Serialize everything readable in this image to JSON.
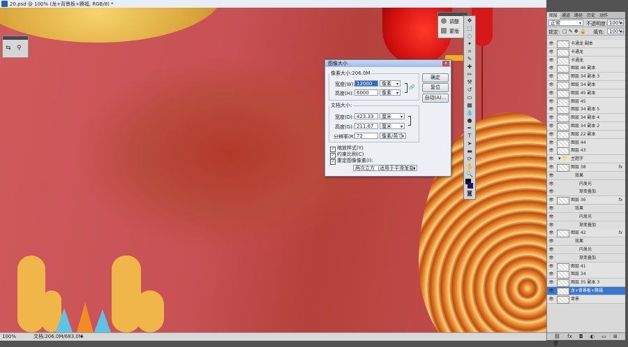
{
  "document": {
    "tab_title": "20.psd @ 100% (龙+背景板+腾福, RGB/8) *"
  },
  "status_bar": {
    "zoom": "100%",
    "doc_info": "文档:206.0M/683.0M"
  },
  "mini_panel": {
    "items": [
      {
        "label": "调整"
      },
      {
        "label": "蒙版"
      }
    ]
  },
  "dialog": {
    "title": "图像大小",
    "close": "x",
    "pixel_dimensions_label": "像素大小:206.0M",
    "width_label": "宽度(W):",
    "width_value": "12000",
    "width_unit": "像素",
    "height_label": "高度(H):",
    "height_value": "6000",
    "height_unit": "像素",
    "doc_size_label": "文档大小:",
    "doc_width_label": "宽度(D):",
    "doc_width_value": "423.33",
    "doc_width_unit": "厘米",
    "doc_height_label": "高度(G):",
    "doc_height_value": "211.67",
    "doc_height_unit": "厘米",
    "resolution_label": "分辨率(R):",
    "resolution_value": "72",
    "resolution_unit": "像素/英寸",
    "scale_styles": "缩放样式(Y)",
    "constrain": "约束比例(C)",
    "resample": "重定图像像素(I):",
    "resample_method": "两次立方（适用于平滑渐变）",
    "ok": "确定",
    "reset": "复位",
    "auto": "自动(A)..."
  },
  "layers_panel": {
    "tabs": [
      "图层",
      "通道",
      "路径",
      "历史",
      "动作"
    ],
    "blend_mode": "正常",
    "opacity_label": "不透明度:",
    "opacity": "100%",
    "lock_label": "锁定:",
    "fill_label": "填充:",
    "fill": "100%",
    "layers": [
      {
        "name": "卡通龙 副本",
        "type": "layer"
      },
      {
        "name": "卡通龙",
        "type": "layer"
      },
      {
        "name": "卡通龙",
        "type": "layer"
      },
      {
        "name": "图层 46 副本",
        "type": "layer"
      },
      {
        "name": "图层 34 副本 3",
        "type": "layer"
      },
      {
        "name": "图层 34 副本",
        "type": "layer"
      },
      {
        "name": "图层 45 副本",
        "type": "layer"
      },
      {
        "name": "图层 45",
        "type": "layer"
      },
      {
        "name": "图层 34 副本 5",
        "type": "layer"
      },
      {
        "name": "图层 34 副本 4",
        "type": "layer"
      },
      {
        "name": "图层 34 副本 2",
        "type": "layer"
      },
      {
        "name": "图层 22 副本",
        "type": "layer"
      },
      {
        "name": "图层 44",
        "type": "layer"
      },
      {
        "name": "图层 43",
        "type": "layer"
      },
      {
        "name": "主题字",
        "type": "group"
      },
      {
        "name": "图层 38",
        "type": "layer",
        "fx": "fx"
      },
      {
        "name": "效果",
        "type": "sub"
      },
      {
        "name": "内发光",
        "type": "sub2"
      },
      {
        "name": "渐变叠加",
        "type": "sub2"
      },
      {
        "name": "图层 36",
        "type": "layer",
        "fx": "fx"
      },
      {
        "name": "效果",
        "type": "sub"
      },
      {
        "name": "内发光",
        "type": "sub2"
      },
      {
        "name": "渐变叠加",
        "type": "sub2"
      },
      {
        "name": "图层 42",
        "type": "layer",
        "fx": "fx"
      },
      {
        "name": "效果",
        "type": "sub"
      },
      {
        "name": "内发光",
        "type": "sub2"
      },
      {
        "name": "渐变叠加",
        "type": "sub2"
      },
      {
        "name": "图层 41",
        "type": "layer"
      },
      {
        "name": "图层 34",
        "type": "layer"
      },
      {
        "name": "图层 35 副本 3",
        "type": "layer"
      },
      {
        "name": "龙+背景板+腾福",
        "type": "selected"
      },
      {
        "name": "背景",
        "type": "layer"
      }
    ]
  }
}
